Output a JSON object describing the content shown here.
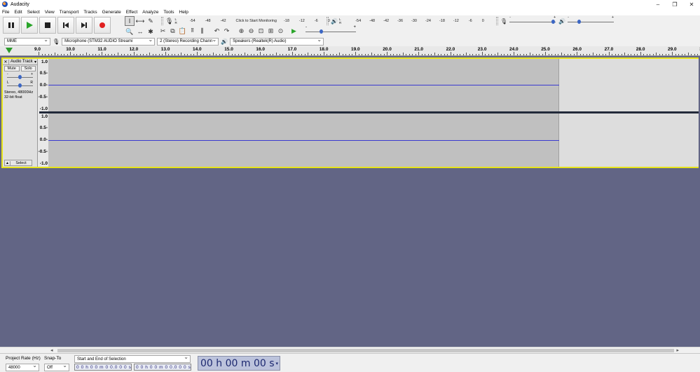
{
  "window": {
    "title": "Audacity",
    "controls": [
      "–",
      "❐",
      "✕"
    ]
  },
  "menu": [
    "File",
    "Edit",
    "Select",
    "View",
    "Transport",
    "Tracks",
    "Generate",
    "Effect",
    "Analyze",
    "Tools",
    "Help"
  ],
  "transport": [
    "pause",
    "play",
    "stop",
    "skip-start",
    "skip-end",
    "record"
  ],
  "tools": {
    "grid": [
      "I",
      "⟷",
      "✎",
      "🔍",
      "↔",
      "✱"
    ],
    "edit": [
      "✂",
      "⧉",
      "📋",
      "⫿⫿",
      "⫼",
      "↶",
      "↷",
      "⊕",
      "⊖",
      "⊡",
      "⊞",
      "⊙",
      "▶"
    ]
  },
  "meters": {
    "record_scale": [
      "-54",
      "-48",
      "-42",
      "-18",
      "-12",
      "-6",
      "0"
    ],
    "record_hint": "Click to Start Monitoring",
    "playback_scale": [
      "-54",
      "-48",
      "-42",
      "-36",
      "-30",
      "-24",
      "-18",
      "-12",
      "-6",
      "0"
    ],
    "lr": [
      "L",
      "R"
    ],
    "minus": "-",
    "plus": "+"
  },
  "devices": {
    "host": "MME",
    "mic": "Microphone (STM32 AUDIO Streami",
    "channels": "2 (Stereo) Recording Chann",
    "speaker": "Speakers (Realtek(R) Audio)"
  },
  "ruler": {
    "labels": [
      "9.0",
      "10.0",
      "11.0",
      "12.0",
      "13.0",
      "14.0",
      "15.0",
      "16.0",
      "17.0",
      "18.0",
      "19.0",
      "20.0",
      "21.0",
      "22.0",
      "23.0",
      "24.0",
      "25.0",
      "26.0",
      "27.0",
      "28.0",
      "29.0",
      "30"
    ]
  },
  "track": {
    "close": "✕",
    "name": "Audio Track",
    "mute": "Mute",
    "solo": "Solo",
    "gain_minus": "-",
    "gain_plus": "+",
    "pan_left": "L",
    "pan_right": "R",
    "info_line1": "Stereo, 48000Hz",
    "info_line2": "32-bit float",
    "select": "Select",
    "select_arrow": "▲",
    "scale": [
      "1.0",
      "0.5-",
      "0.0-",
      "-0.5-",
      "-1.0"
    ]
  },
  "scroll": {
    "left": "◂",
    "right": "▸"
  },
  "selection": {
    "project_rate_label": "Project Rate (Hz)",
    "project_rate": "48000",
    "snap_label": "Snap-To",
    "snap": "Off",
    "mode": "Start and End of Selection",
    "start": "0 0 h 0 0 m 0 0.0 0 0 s",
    "end": "0 0 h 0 0 m 0 0.0 0 0 s",
    "audio_position": "00 h 00 m 00 s"
  }
}
